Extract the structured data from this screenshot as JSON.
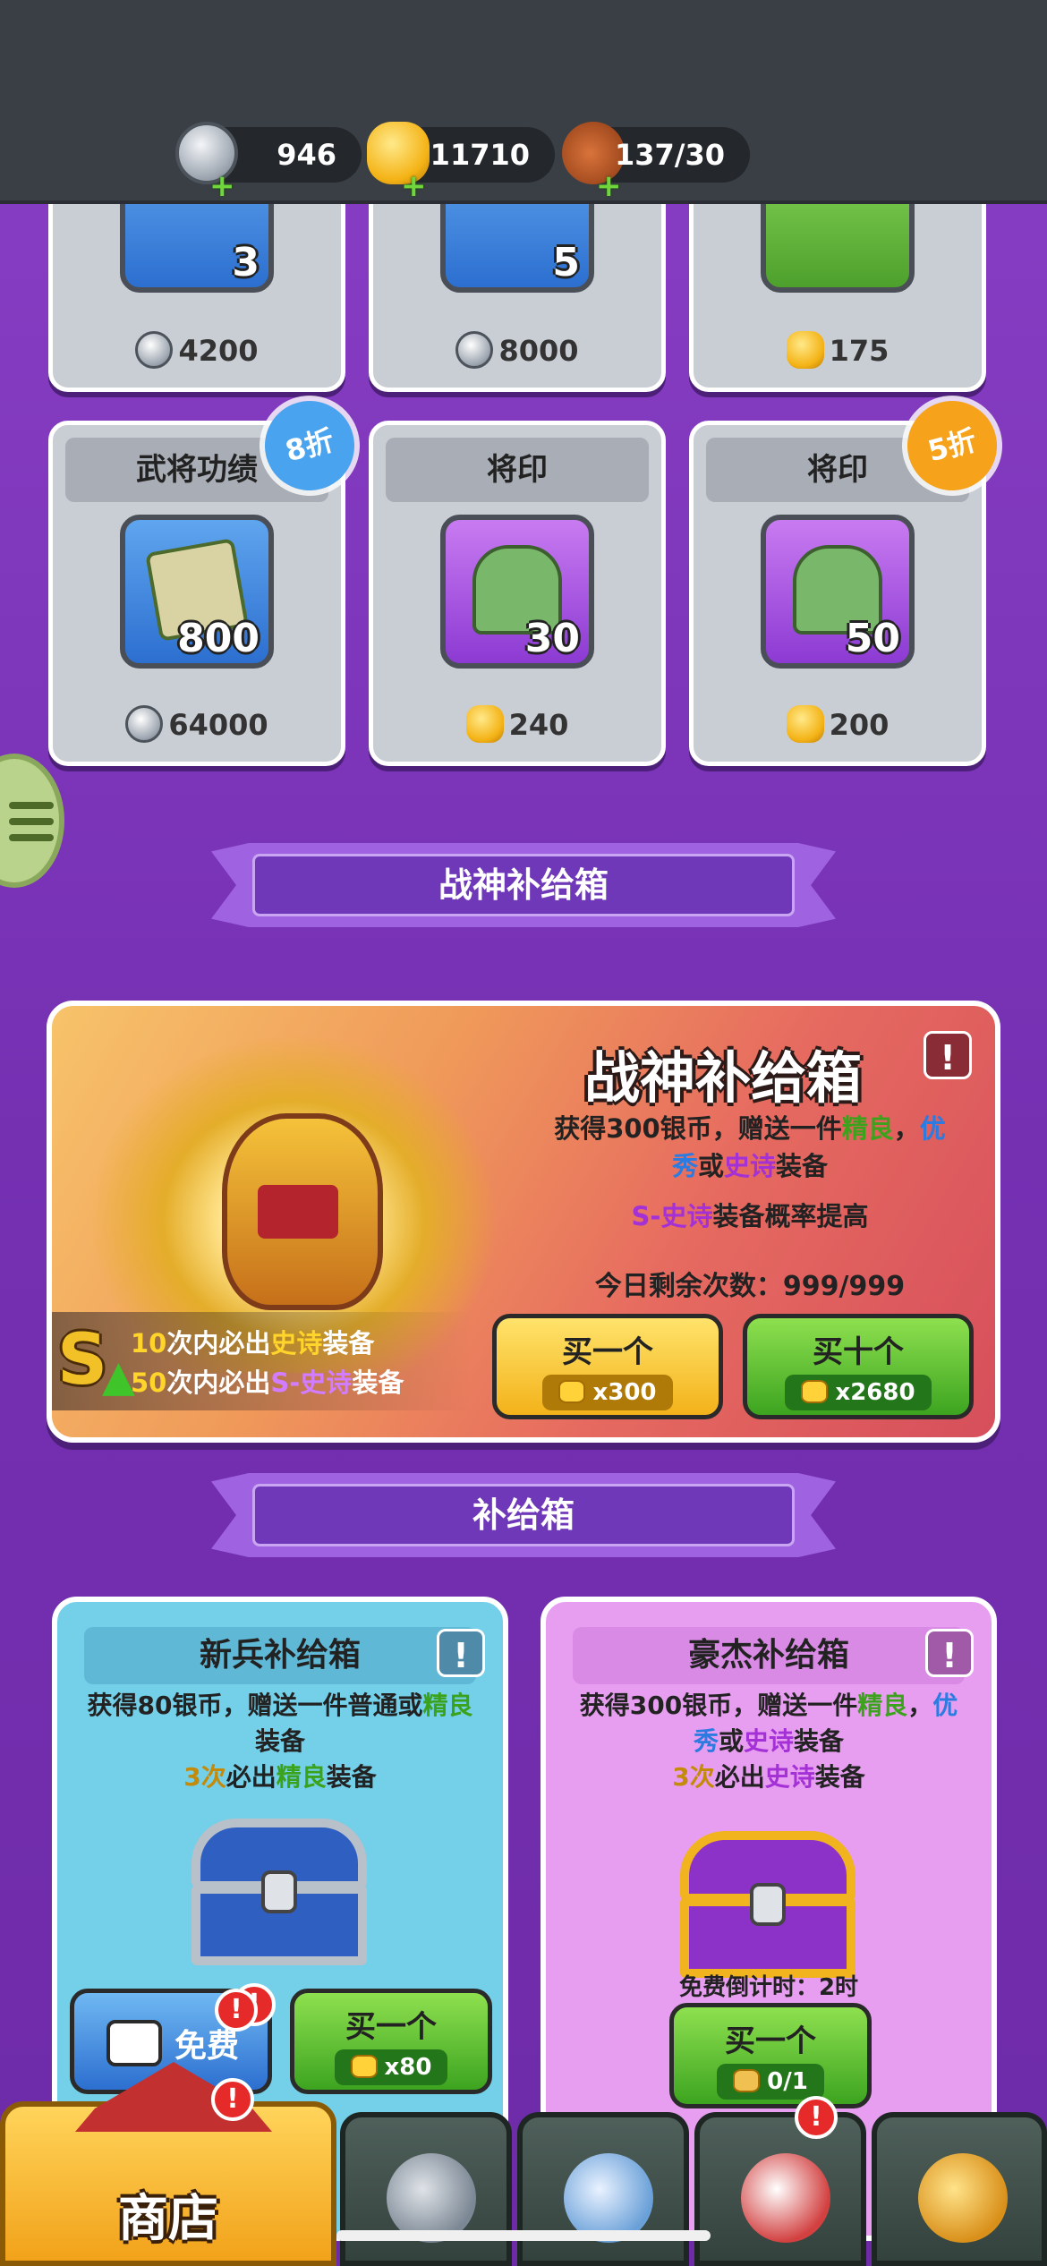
{
  "resources": [
    {
      "icon": "silver-coin-icon",
      "value": "946"
    },
    {
      "icon": "gold-ingot-icon",
      "value": "11710"
    },
    {
      "icon": "meat-stamina-icon",
      "value": "137/30"
    }
  ],
  "shop_top_row": [
    {
      "qty": "3",
      "price": "4200",
      "currency": "silver"
    },
    {
      "qty": "5",
      "price": "8000",
      "currency": "silver"
    },
    {
      "qty": "",
      "price": "175",
      "currency": "gold"
    }
  ],
  "shop_items": [
    {
      "title": "武将功绩",
      "qty": "800",
      "price": "64000",
      "currency": "silver",
      "discount": "8折",
      "icon": "scroll-icon"
    },
    {
      "title": "将印",
      "qty": "30",
      "price": "240",
      "currency": "gold",
      "discount": "",
      "icon": "jade-seal-icon"
    },
    {
      "title": "将印",
      "qty": "50",
      "price": "200",
      "currency": "gold",
      "discount": "5折",
      "icon": "jade-seal-icon"
    }
  ],
  "banners": {
    "wargod": "战神补给箱",
    "supply": "补给箱"
  },
  "wargod_box": {
    "title": "战神补给箱",
    "desc_line1_a": "获得300银币，赠送一件",
    "desc_line1_b": "精良",
    "desc_line1_c": "，",
    "desc_line1_d": "优",
    "desc_line2_a": "秀",
    "desc_line2_b": "或",
    "desc_line2_c": "史诗",
    "desc_line2_d": "装备",
    "rate_a": "S-史诗",
    "rate_b": "装备概率提高",
    "remaining": "今日剩余次数：999/999",
    "guarantee1_a": "10",
    "guarantee1_b": "次内必出",
    "guarantee1_c": "史诗",
    "guarantee1_d": "装备",
    "guarantee2_a": "50",
    "guarantee2_b": "次内必出",
    "guarantee2_c": "S-史诗",
    "guarantee2_d": "装备",
    "buy_one_label": "买一个",
    "buy_one_price": "x300",
    "buy_ten_label": "买十个",
    "buy_ten_price": "x2680"
  },
  "recruit_box": {
    "title": "新兵补给箱",
    "desc_a": "获得80银币，赠送一件普通或",
    "desc_b": "精良",
    "desc_c": "装备",
    "guar_a": "3次",
    "guar_b": "必出",
    "guar_c": "精良",
    "guar_d": "装备",
    "free_label": "免费",
    "buy_label": "买一个",
    "buy_price": "x80"
  },
  "hero_box": {
    "title": "豪杰补给箱",
    "desc_a": "获得300银币，赠送一件",
    "desc_b": "精良",
    "desc_c": "，",
    "desc_d": "优",
    "desc2_a": "秀",
    "desc2_b": "或",
    "desc2_c": "史诗",
    "desc2_d": "装备",
    "guar_a": "3次",
    "guar_b": "必出",
    "guar_c": "史诗",
    "guar_d": "装备",
    "timer": "免费倒计时：2时",
    "buy_label": "买一个",
    "buy_price": "0/1"
  },
  "nav": {
    "shop": "商店"
  },
  "colors": {
    "background": "#7b34b8",
    "accent_green": "#3aa21b",
    "accent_blue": "#2b7be0",
    "accent_purple": "#a431d6"
  }
}
